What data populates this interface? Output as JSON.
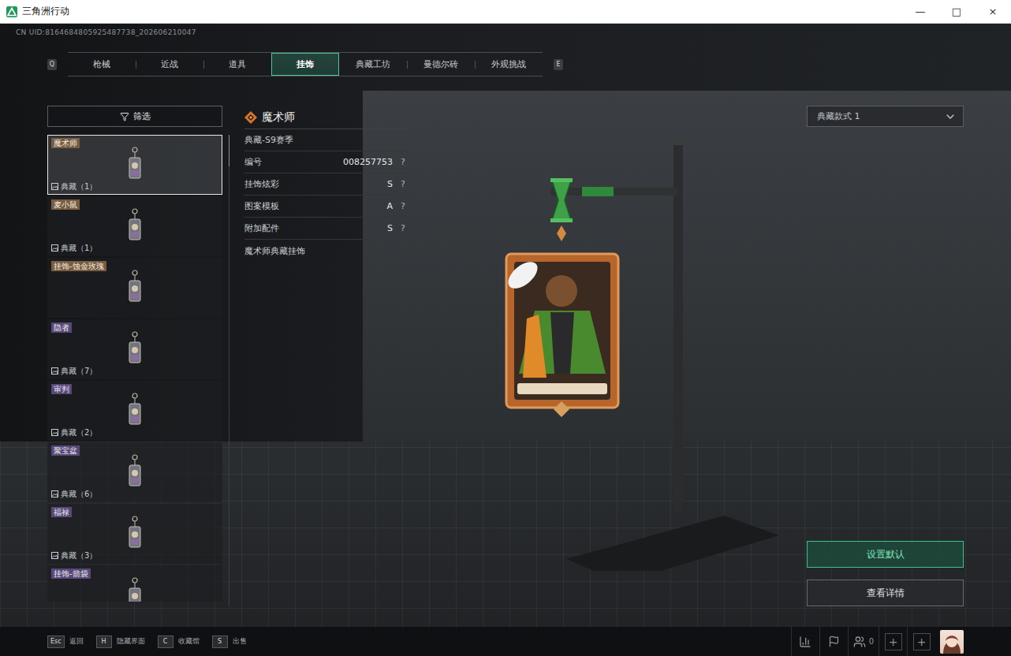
{
  "window": {
    "title": "三角洲行动",
    "controls": [
      "—",
      "□",
      "×"
    ]
  },
  "uid": "CN UID:8164684805925487738_202606210047",
  "tabs": {
    "prev_key": "Q",
    "next_key": "E",
    "items": [
      {
        "label": "枪械",
        "selected": false
      },
      {
        "label": "近战",
        "selected": false
      },
      {
        "label": "道具",
        "selected": false
      },
      {
        "label": "挂饰",
        "selected": true
      },
      {
        "label": "典藏工坊",
        "selected": false
      },
      {
        "label": "曼德尔砖",
        "selected": false
      },
      {
        "label": "外观挑战",
        "selected": false
      }
    ]
  },
  "filter": {
    "label": "筛选"
  },
  "items": [
    {
      "name": "魔术师",
      "badge": "典藏（1）",
      "selected": true,
      "color": "#7a5c3e"
    },
    {
      "name": "麦小鼠",
      "badge": "典藏（1）",
      "selected": false,
      "color": "#7a5c3e"
    },
    {
      "name": "挂饰-蚀金玫瑰",
      "badge": "",
      "selected": false,
      "color": "#7a5c3e"
    },
    {
      "name": "隐者",
      "badge": "典藏（7）",
      "selected": false,
      "color": "#56487a"
    },
    {
      "name": "审判",
      "badge": "典藏（2）",
      "selected": false,
      "color": "#56487a"
    },
    {
      "name": "聚宝盆",
      "badge": "典藏（6）",
      "selected": false,
      "color": "#56487a"
    },
    {
      "name": "福禄",
      "badge": "典藏（3）",
      "selected": false,
      "color": "#56487a"
    },
    {
      "name": "挂饰-箭袋",
      "badge": "",
      "selected": false,
      "color": "#56487a"
    }
  ],
  "detail": {
    "title": "魔术师",
    "season": "典藏-S9赛季",
    "rows": [
      {
        "label": "编号",
        "value": "008257753",
        "help": "?"
      },
      {
        "label": "挂饰炫彩",
        "value": "S",
        "help": "?"
      },
      {
        "label": "图案模板",
        "value": "A",
        "help": "?"
      },
      {
        "label": "附加配件",
        "value": "S",
        "help": "?"
      }
    ],
    "description": "魔术师典藏挂饰"
  },
  "style_select": {
    "value": "典藏款式 1"
  },
  "buttons": [
    {
      "label": "设置默认",
      "selected": true
    },
    {
      "label": "查看详情",
      "selected": false
    }
  ],
  "footer": {
    "hints": [
      {
        "key": "Esc",
        "label": "返回"
      },
      {
        "key": "H",
        "label": "隐藏界面"
      },
      {
        "key": "C",
        "label": "收藏馆"
      },
      {
        "key": "S",
        "label": "出售"
      }
    ],
    "friends": "0",
    "plus": [
      "+",
      "+"
    ]
  }
}
